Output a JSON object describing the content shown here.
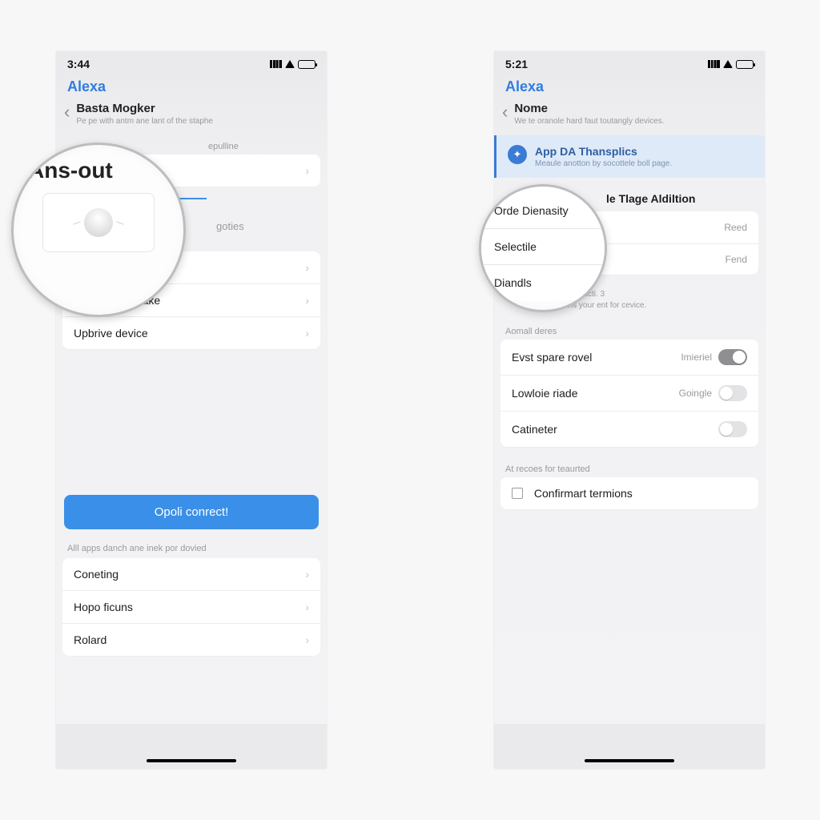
{
  "left": {
    "status_time": "3:44",
    "brand": "Alexa",
    "nav": {
      "title": "Basta Mogker",
      "subtitle": "Pe pe with antm ane lant of the staphe"
    },
    "section_top_label": "epulline",
    "tabs_divider": true,
    "rows_a_label": "goties",
    "rows_a": [
      {
        "label": "Cortarobiam rake"
      },
      {
        "label": "Upbrive device"
      }
    ],
    "primary_button": "Opoli conrect!",
    "footer_label": "Alll apps danch ane inek por dovied",
    "footer_rows": [
      {
        "label": "Coneting"
      },
      {
        "label": "Hopo ficuns"
      },
      {
        "label": "Rolard"
      }
    ],
    "magnifier": {
      "label": "Ans-out"
    }
  },
  "right": {
    "status_time": "5:21",
    "brand": "Alexa",
    "nav": {
      "title": "Nome",
      "subtitle": "We te oranole hard faut toutangly devices."
    },
    "banner": {
      "title": "App DA Thansplics",
      "subtitle": "Meaule anotton by socottele boll page."
    },
    "section_title": "le Tlage Aldiltion",
    "group1": [
      {
        "label": "e",
        "right": "Reed"
      },
      {
        "label": "",
        "right": "Fend"
      }
    ],
    "hint": {
      "line1": "with lech an spill ucti. 3",
      "line2": "Olay too hoans your ent for cevice."
    },
    "group2_label": "Aomall deres",
    "group2": [
      {
        "label": "Evst spare rovel",
        "right": "Imieriel",
        "toggle": true,
        "on": true
      },
      {
        "label": "Lowloie riade",
        "right": "Goingle",
        "toggle": true,
        "on": false
      },
      {
        "label": "Catineter",
        "right": "",
        "toggle": true,
        "on": false
      }
    ],
    "group3_label": "At recoes for teaurted",
    "group3": [
      {
        "label": "Confirmart termions",
        "checkbox": true
      }
    ],
    "magnifier": {
      "rows": [
        "Orde Dienasity",
        "Selectile",
        "Diandls"
      ]
    }
  }
}
